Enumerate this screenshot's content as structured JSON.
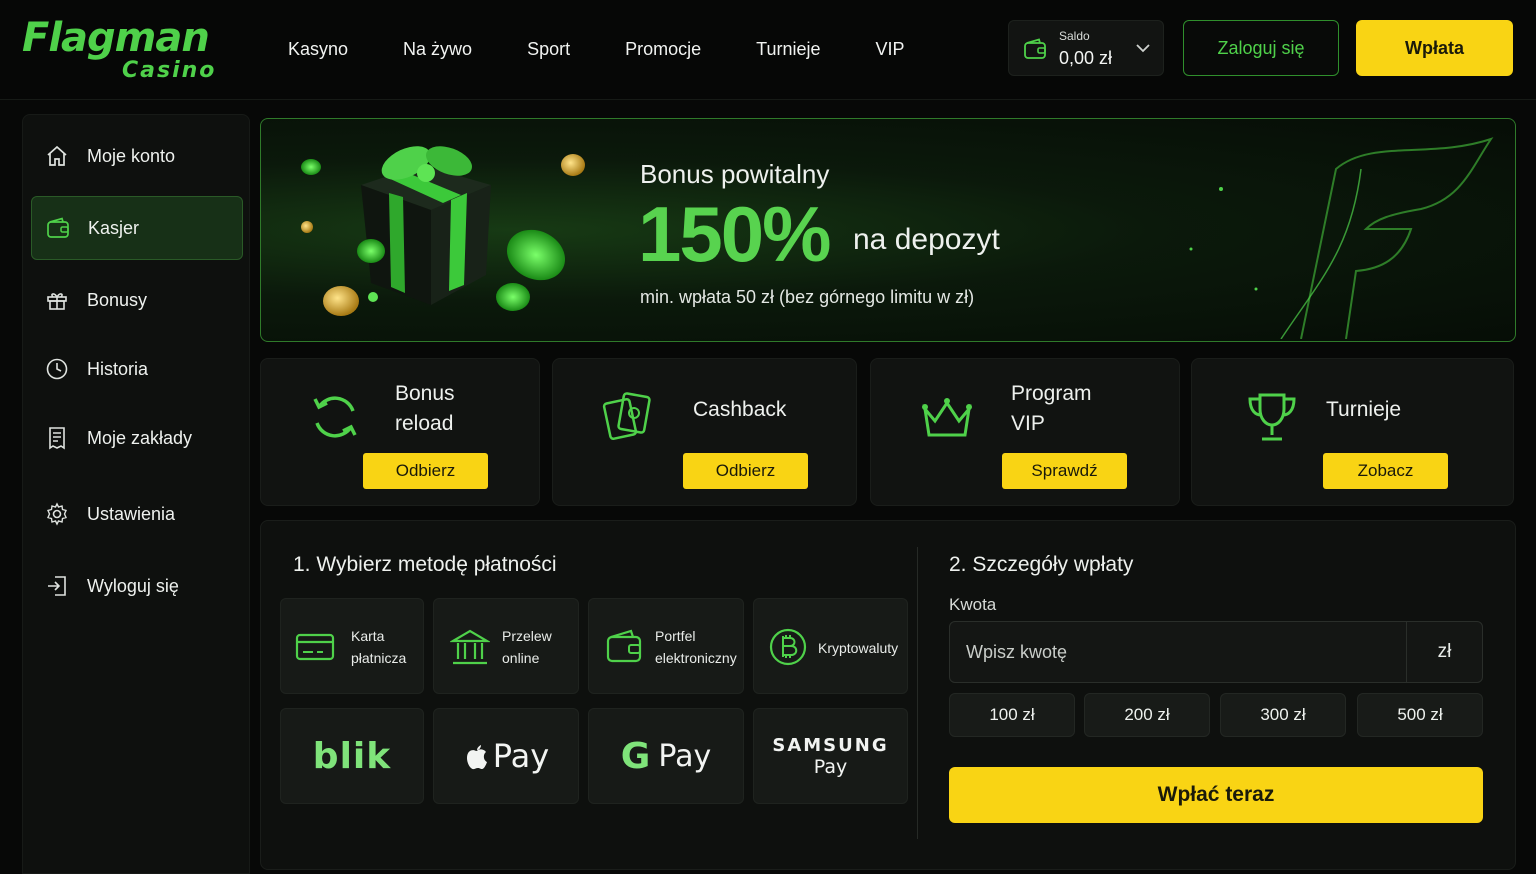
{
  "brand": {
    "name": "Flagman",
    "sub": "Casino"
  },
  "nav": [
    "Kasyno",
    "Na żywo",
    "Sport",
    "Promocje",
    "Turnieje",
    "VIP"
  ],
  "balance": {
    "label": "Saldo",
    "value": "0,00 zł"
  },
  "header_buttons": {
    "login": "Zaloguj się",
    "deposit": "Wpłata"
  },
  "sidebar": {
    "items": [
      {
        "label": "Moje konto",
        "icon": "home-icon"
      },
      {
        "label": "Kasjer",
        "icon": "wallet-icon",
        "active": true
      },
      {
        "label": "Bonusy",
        "icon": "gift-icon"
      },
      {
        "label": "Historia",
        "icon": "clock-icon"
      },
      {
        "label": "Moje zakłady",
        "icon": "receipt-icon"
      },
      {
        "label": "Ustawienia",
        "icon": "gear-icon"
      },
      {
        "label": "Wyloguj się",
        "icon": "logout-icon"
      }
    ]
  },
  "hero": {
    "title": "Bonus powitalny",
    "percent": "150%",
    "suffix": "na depozyt",
    "note": "min. wpłata 50 zł (bez górnego limitu w zł)"
  },
  "promos": [
    {
      "line1": "Bonus",
      "line2": "reload",
      "button": "Odbierz",
      "icon": "refresh-icon"
    },
    {
      "line1": "Cashback",
      "line2": "",
      "button": "Odbierz",
      "icon": "cards-icon"
    },
    {
      "line1": "Program",
      "line2": "VIP",
      "button": "Sprawdź",
      "icon": "crown-icon"
    },
    {
      "line1": "Turnieje",
      "line2": "",
      "button": "Zobacz",
      "icon": "trophy-icon"
    }
  ],
  "payment": {
    "step1": "1. Wybierz metodę płatności",
    "methods": [
      {
        "line1": "Karta",
        "line2": "płatnicza",
        "icon": "credit-card-icon"
      },
      {
        "line1": "Przelew",
        "line2": "online",
        "icon": "bank-icon"
      },
      {
        "line1": "Portfel",
        "line2": "elektroniczny",
        "icon": "wallet-icon"
      },
      {
        "line1": "Kryptowaluty",
        "line2": "",
        "icon": "bitcoin-icon"
      }
    ],
    "brands": [
      "blik",
      "Pay",
      "Pay",
      "SAMSUNG",
      "Pay"
    ],
    "step2": "2. Szczegóły wpłaty",
    "amount_label": "Kwota",
    "amount_placeholder": "Wpisz kwotę",
    "currency": "zł",
    "quick_amounts": [
      "100 zł",
      "200 zł",
      "300 zł",
      "500 zł"
    ],
    "submit": "Wpłać teraz"
  },
  "colors": {
    "accent_green": "#4fd14a",
    "accent_yellow": "#f9d414",
    "background": "#070807"
  }
}
